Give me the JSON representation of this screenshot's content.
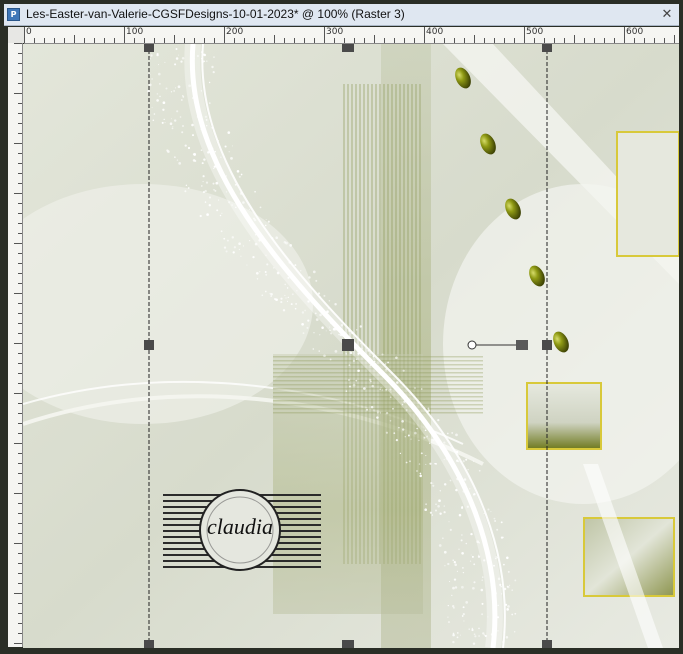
{
  "window": {
    "title": "Les-Easter-van-Valerie-CGSFDesigns-10-01-2023* @ 100% (Raster 3)",
    "close_glyph": "✕",
    "app_icon_glyph": "P"
  },
  "ruler": {
    "labels": [
      "0",
      "100",
      "200",
      "300",
      "400",
      "500",
      "600"
    ]
  },
  "watermark": {
    "text": "claudia"
  },
  "colors": {
    "accent_olive": "#6f7a1f",
    "frame_gold": "#d8c93a",
    "background": "#dfe2d6"
  }
}
